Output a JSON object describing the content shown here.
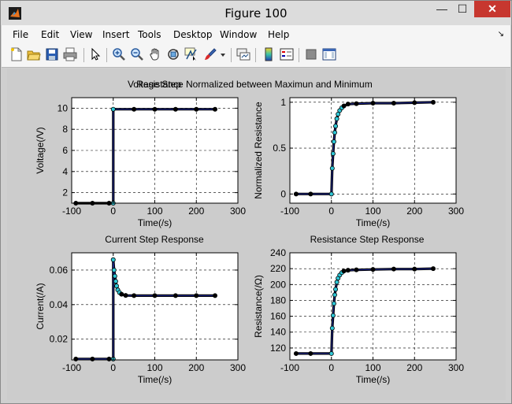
{
  "window": {
    "title": "Figure 100",
    "minimize": "—",
    "maximize": "☐",
    "close": "✕"
  },
  "menu": [
    "File",
    "Edit",
    "View",
    "Insert",
    "Tools",
    "Desktop",
    "Window",
    "Help"
  ],
  "menu_dock_glyph": "↘",
  "toolbar_icons": [
    "new-figure-icon",
    "open-file-icon",
    "save-icon",
    "print-icon",
    "edit-plot-icon",
    "zoom-in-icon",
    "zoom-out-icon",
    "pan-icon",
    "rotate-3d-icon",
    "data-cursor-icon",
    "brush-icon",
    "brush-dropdown-icon",
    "link-plot-icon",
    "colorbar-icon",
    "legend-icon",
    "hide-plot-tools-icon",
    "show-plot-tools-icon"
  ],
  "chart_data": [
    {
      "type": "line",
      "title": "Voltage Step",
      "xlabel": "Time(/s)",
      "ylabel": "Voltage(/V)",
      "xlim": [
        -100,
        300
      ],
      "ylim": [
        1,
        11
      ],
      "xticks": [
        -100,
        0,
        100,
        200,
        300
      ],
      "yticks": [
        2,
        4,
        6,
        8,
        10
      ],
      "grid": true,
      "series": [
        {
          "x": [
            -90,
            -50,
            -10,
            0,
            0,
            50,
            100,
            150,
            200,
            245
          ],
          "y": [
            1,
            1,
            1,
            1,
            9.9,
            9.9,
            9.9,
            9.9,
            9.9,
            9.9
          ]
        }
      ]
    },
    {
      "type": "line",
      "title": "Resistance Normalized between Maximun and Minimum",
      "xlabel": "Time(/s)",
      "ylabel": "Normalized Resistance",
      "xlim": [
        -100,
        300
      ],
      "ylim": [
        -0.1,
        1.05
      ],
      "xticks": [
        -100,
        0,
        100,
        200,
        300
      ],
      "yticks": [
        0,
        0.5,
        1
      ],
      "grid": true,
      "series": [
        {
          "x": [
            -85,
            -50,
            0,
            2,
            4,
            6,
            8,
            10,
            13,
            16,
            20,
            25,
            30,
            40,
            60,
            100,
            150,
            200,
            245
          ],
          "y": [
            0,
            0,
            0,
            0.28,
            0.44,
            0.57,
            0.67,
            0.74,
            0.82,
            0.87,
            0.91,
            0.94,
            0.96,
            0.98,
            0.985,
            0.99,
            0.99,
            0.995,
            1.0
          ]
        }
      ]
    },
    {
      "type": "line",
      "title": "Current Step Response",
      "xlabel": "Time(/s)",
      "ylabel": "Current(/A)",
      "xlim": [
        -100,
        300
      ],
      "ylim": [
        0.008,
        0.07
      ],
      "xticks": [
        -100,
        0,
        100,
        200,
        300
      ],
      "yticks": [
        0.02,
        0.04,
        0.06
      ],
      "grid": true,
      "series": [
        {
          "x": [
            -90,
            -50,
            -10,
            0,
            0,
            2,
            4,
            6,
            8,
            11,
            15,
            20,
            30,
            50,
            100,
            150,
            200,
            245
          ],
          "y": [
            0.0085,
            0.0085,
            0.0085,
            0.0085,
            0.066,
            0.06,
            0.0565,
            0.0535,
            0.0508,
            0.0485,
            0.047,
            0.046,
            0.0453,
            0.0452,
            0.0452,
            0.0452,
            0.0452,
            0.0452
          ]
        }
      ]
    },
    {
      "type": "line",
      "title": "Resistance Step Response",
      "xlabel": "Time(/s)",
      "ylabel": "Resistance(/Ω)",
      "xlim": [
        -100,
        300
      ],
      "ylim": [
        105,
        240
      ],
      "xticks": [
        -100,
        0,
        100,
        200,
        300
      ],
      "yticks": [
        120,
        140,
        160,
        180,
        200,
        220,
        240
      ],
      "grid": true,
      "series": [
        {
          "x": [
            -85,
            -50,
            0,
            2,
            4,
            6,
            8,
            10,
            13,
            16,
            20,
            25,
            30,
            40,
            60,
            100,
            150,
            200,
            245
          ],
          "y": [
            113,
            113,
            113,
            145,
            161,
            176,
            187,
            194,
            203,
            208,
            212,
            215,
            217,
            218,
            218.5,
            219,
            219.5,
            219.5,
            220
          ]
        }
      ]
    }
  ]
}
